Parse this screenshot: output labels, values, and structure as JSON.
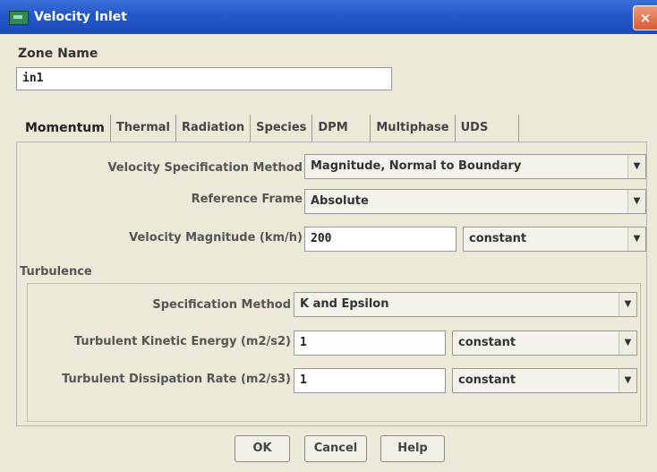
{
  "window": {
    "title": "Velocity Inlet",
    "close_label": "×"
  },
  "zone": {
    "label": "Zone Name",
    "value": "in1"
  },
  "tabs": [
    {
      "label": "Momentum",
      "active": true
    },
    {
      "label": "Thermal"
    },
    {
      "label": "Radiation"
    },
    {
      "label": "Species"
    },
    {
      "label": "DPM"
    },
    {
      "label": "Multiphase"
    },
    {
      "label": "UDS"
    }
  ],
  "momentum": {
    "velocity_spec_label": "Velocity Specification Method",
    "velocity_spec_value": "Magnitude, Normal to Boundary",
    "reference_frame_label": "Reference Frame",
    "reference_frame_value": "Absolute",
    "velocity_magnitude_label": "Velocity Magnitude (km/h)",
    "velocity_magnitude_value": "200",
    "velocity_magnitude_profile": "constant"
  },
  "turbulence": {
    "section_label": "Turbulence",
    "spec_method_label": "Specification Method",
    "spec_method_value": "K and Epsilon",
    "tke_label": "Turbulent Kinetic Energy (m2/s2)",
    "tke_value": "1",
    "tke_profile": "constant",
    "tdr_label": "Turbulent Dissipation Rate (m2/s3)",
    "tdr_value": "1",
    "tdr_profile": "constant"
  },
  "buttons": {
    "ok": "OK",
    "cancel": "Cancel",
    "help": "Help"
  },
  "icons": {
    "window_icon": "app-icon",
    "dropdown": "chevron-down-icon"
  },
  "colors": {
    "titlebar": "#2458c9",
    "close": "#d85a32",
    "background": "#ece9d8"
  }
}
